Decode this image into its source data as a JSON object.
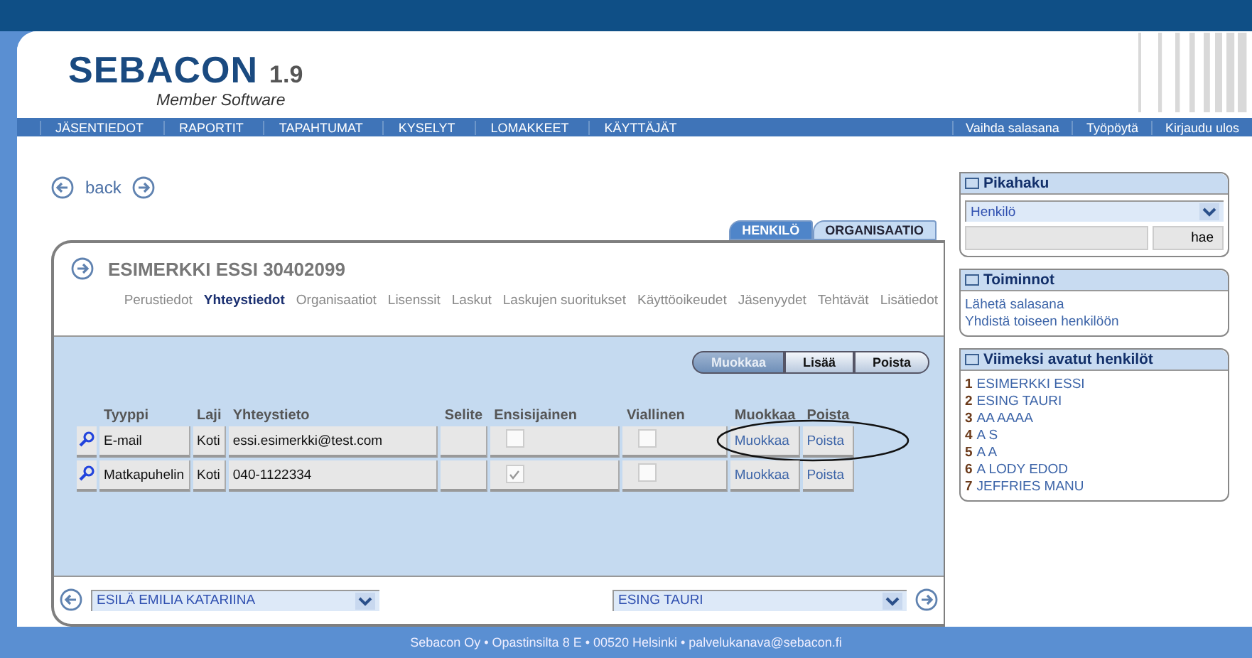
{
  "header": {
    "logo": "SEBACON",
    "version": "1.9",
    "tagline": "Member Software"
  },
  "nav": {
    "left": [
      "JÄSENTIEDOT",
      "RAPORTIT",
      "TAPAHTUMAT",
      "KYSELYT",
      "LOMAKKEET",
      "KÄYTTÄJÄT"
    ],
    "right": [
      "Vaihda salasana",
      "Työpöytä",
      "Kirjaudu ulos"
    ]
  },
  "back": "back",
  "entity_tabs": [
    {
      "label": "HENKILÖ",
      "selected": true
    },
    {
      "label": "ORGANISAATIO",
      "selected": false
    }
  ],
  "person": {
    "title": "ESIMERKKI ESSI 30402099"
  },
  "subtabs": [
    {
      "label": "Perustiedot",
      "selected": false
    },
    {
      "label": "Yhteystiedot",
      "selected": true
    },
    {
      "label": "Organisaatiot",
      "selected": false
    },
    {
      "label": "Lisenssit",
      "selected": false
    },
    {
      "label": "Laskut",
      "selected": false
    },
    {
      "label": "Laskujen suoritukset",
      "selected": false
    },
    {
      "label": "Käyttöoikeudet",
      "selected": false
    },
    {
      "label": "Jäsenyydet",
      "selected": false
    },
    {
      "label": "Tehtävät",
      "selected": false
    },
    {
      "label": "Lisätiedot",
      "selected": false
    }
  ],
  "actions": [
    {
      "label": "Muokkaa",
      "disabled": true
    },
    {
      "label": "Lisää",
      "disabled": false
    },
    {
      "label": "Poista",
      "disabled": false
    }
  ],
  "table": {
    "columns": [
      "Tyyppi",
      "Laji",
      "Yhteystieto",
      "Selite",
      "Ensisijainen",
      "Viallinen",
      "Muokkaa",
      "Poista"
    ],
    "rows": [
      {
        "type": "E-mail",
        "kind": "Koti",
        "contact": "essi.esimerkki@test.com",
        "primary": false,
        "faulty": false,
        "edit": "Muokkaa",
        "delete": "Poista",
        "circled": true
      },
      {
        "type": "Matkapuhelin",
        "kind": "Koti",
        "contact": "040-1122334",
        "primary": true,
        "faulty": false,
        "edit": "Muokkaa",
        "delete": "Poista",
        "circled": false
      }
    ]
  },
  "pager": {
    "previous": "ESILÄ EMILIA KATARIINA",
    "next": "ESING TAURI"
  },
  "quick_search": {
    "title": "Pikahaku",
    "select": "Henkilö",
    "button": "hae"
  },
  "actions_box": {
    "title": "Toiminnot",
    "links": [
      "Lähetä salasana",
      "Yhdistä toiseen henkilöön"
    ]
  },
  "recent": {
    "title": "Viimeksi avatut henkilöt",
    "items": [
      {
        "number": "1",
        "name": "ESIMERKKI ESSI"
      },
      {
        "number": "2",
        "name": "ESING TAURI"
      },
      {
        "number": "3",
        "name": "AA AAAA"
      },
      {
        "number": "4",
        "name": "A S"
      },
      {
        "number": "5",
        "name": "A A"
      },
      {
        "number": "6",
        "name": "A LODY EDOD"
      },
      {
        "number": "7",
        "name": "JEFFRIES MANU"
      }
    ]
  },
  "footer": "Sebacon Oy • Opastinsilta 8 E • 00520 Helsinki • palvelukanava@sebacon.fi"
}
